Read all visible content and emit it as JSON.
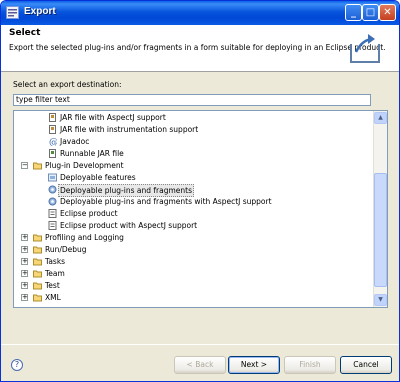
{
  "window": {
    "title": "Export"
  },
  "banner": {
    "heading": "Select",
    "description": "Export the selected plug-ins and/or fragments in a form suitable for deploying in an Eclipse product."
  },
  "destination": {
    "label": "Select an export destination:",
    "filter_value": "type filter text"
  },
  "tree": {
    "items": [
      {
        "label": "JAR file with AspectJ support",
        "icon": "jar-file-icon",
        "selected": false
      },
      {
        "label": "JAR file with instrumentation support",
        "icon": "jar-file-icon",
        "selected": false
      },
      {
        "label": "Javadoc",
        "icon": "javadoc-icon",
        "selected": false
      },
      {
        "label": "Runnable JAR file",
        "icon": "jar-file-icon",
        "selected": false
      },
      {
        "label": "Plug-in Development",
        "icon": "folder-open-icon",
        "expander": "−",
        "selected": false
      },
      {
        "label": "Deployable features",
        "icon": "feature-icon",
        "selected": false
      },
      {
        "label": "Deployable plug-ins and fragments",
        "icon": "plugin-icon",
        "selected": true
      },
      {
        "label": "Deployable plug-ins and fragments with AspectJ support",
        "icon": "plugin-icon",
        "selected": false
      },
      {
        "label": "Eclipse product",
        "icon": "product-icon",
        "selected": false
      },
      {
        "label": "Eclipse product with AspectJ support",
        "icon": "product-icon",
        "selected": false
      },
      {
        "label": "Profiling and Logging",
        "icon": "folder-icon",
        "expander": "+",
        "selected": false
      },
      {
        "label": "Run/Debug",
        "icon": "folder-icon",
        "expander": "+",
        "selected": false
      },
      {
        "label": "Tasks",
        "icon": "folder-icon",
        "expander": "+",
        "selected": false
      },
      {
        "label": "Team",
        "icon": "folder-icon",
        "expander": "+",
        "selected": false
      },
      {
        "label": "Test",
        "icon": "folder-icon",
        "expander": "+",
        "selected": false
      },
      {
        "label": "XML",
        "icon": "folder-icon",
        "expander": "+",
        "selected": false
      }
    ]
  },
  "buttons": {
    "back": "< Back",
    "next": "Next >",
    "finish": "Finish",
    "cancel": "Cancel"
  },
  "colors": {
    "titlebar": "#0a5fe8",
    "dialog_bg": "#ece9d8",
    "border": "#7f9db9"
  }
}
